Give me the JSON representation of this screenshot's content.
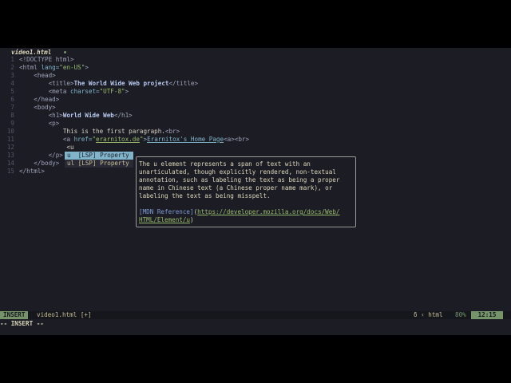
{
  "tab": {
    "filename": "video1.html"
  },
  "lines": [
    {
      "n": "1",
      "parts": [
        [
          "t",
          "<!DOCTYPE html>"
        ]
      ]
    },
    {
      "n": "2",
      "parts": [
        [
          "t",
          "<html "
        ],
        [
          "n",
          "lang="
        ],
        [
          "v",
          "\"en-US\""
        ],
        [
          "t",
          ">"
        ]
      ]
    },
    {
      "n": "3",
      "parts": [
        [
          "",
          "    "
        ],
        [
          "t",
          "<head>"
        ]
      ]
    },
    {
      "n": "4",
      "parts": [
        [
          "",
          "        "
        ],
        [
          "t",
          "<title>"
        ],
        [
          "b",
          "The World Wide Web project"
        ],
        [
          "t",
          "</title>"
        ]
      ]
    },
    {
      "n": "5",
      "parts": [
        [
          "",
          "        "
        ],
        [
          "t",
          "<meta "
        ],
        [
          "n",
          "charset="
        ],
        [
          "v",
          "\"UTF-8\""
        ],
        [
          "t",
          ">"
        ]
      ]
    },
    {
      "n": "6",
      "parts": [
        [
          "",
          "    "
        ],
        [
          "t",
          "</head>"
        ]
      ]
    },
    {
      "n": "7",
      "parts": [
        [
          "",
          "    "
        ],
        [
          "t",
          "<body>"
        ]
      ]
    },
    {
      "n": "8",
      "parts": [
        [
          "",
          "        "
        ],
        [
          "t",
          "<h1>"
        ],
        [
          "b",
          "World Wide Web"
        ],
        [
          "t",
          "</h1>"
        ]
      ]
    },
    {
      "n": "9",
      "parts": [
        [
          "",
          "        "
        ],
        [
          "t",
          "<p>"
        ]
      ]
    },
    {
      "n": "10",
      "parts": [
        [
          "",
          "            This is the first paragraph."
        ],
        [
          "t",
          "<br>"
        ]
      ]
    },
    {
      "n": "11",
      "parts": [
        [
          "",
          "            "
        ],
        [
          "t",
          "<a "
        ],
        [
          "n",
          "href="
        ],
        [
          "v",
          "\""
        ],
        [
          "v u",
          "erarnitox.de"
        ],
        [
          "v",
          "\""
        ],
        [
          "t",
          ">"
        ],
        [
          "n u",
          "Erarnitox's Home Page"
        ],
        [
          "t",
          "<a><br>"
        ]
      ]
    },
    {
      "n": "12",
      "parts": [
        [
          "",
          "             <u"
        ]
      ]
    },
    {
      "n": "13",
      "parts": [
        [
          "",
          "        "
        ],
        [
          "t",
          "</p>"
        ]
      ]
    },
    {
      "n": "14",
      "parts": [
        [
          "",
          "    "
        ],
        [
          "t",
          "</body>"
        ]
      ]
    },
    {
      "n": "15",
      "parts": [
        [
          "t",
          "</html>"
        ]
      ]
    }
  ],
  "completion": [
    {
      "label": "u  [LSP] Property",
      "selected": true
    },
    {
      "label": "ul [LSP] Property",
      "selected": false
    }
  ],
  "doc": {
    "text": "The u element represents a span of text with an\nunarticulated, though explicitly rendered, non-textual\nannotation, such as labeling the text as being a proper\nname in Chinese text (a Chinese proper name mark), or\nlabeling the text as being misspelt.\n\n",
    "ref": "[MDN Reference]",
    "url": "https://developer.mozilla.org/docs/Web/\nHTML/Element/u",
    "close": ")",
    "open": "("
  },
  "status": {
    "mode": "INSERT",
    "file": "video1.html [+]",
    "filetype": "δ ‹ html",
    "percent": "80%",
    "position": "12:15"
  },
  "cmdline": "-- INSERT --"
}
